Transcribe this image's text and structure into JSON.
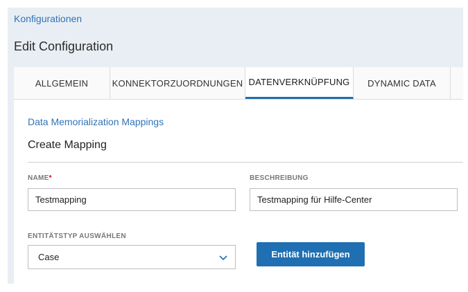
{
  "breadcrumb": "Konfigurationen",
  "page_title": "Edit Configuration",
  "tabs": [
    {
      "label": "ALLGEMEIN",
      "active": false
    },
    {
      "label": "KONNEKTORZUORDNUNGEN",
      "active": false
    },
    {
      "label": "DATENVERKNÜPFUNG",
      "active": true
    },
    {
      "label": "DYNAMIC DATA",
      "active": false
    }
  ],
  "section_title": "Data Memorialization Mappings",
  "form_heading": "Create Mapping",
  "fields": {
    "name": {
      "label": "NAME",
      "required_mark": "*",
      "value": "Testmapping"
    },
    "description": {
      "label": "BESCHREIBUNG",
      "value": "Testmapping für Hilfe-Center"
    },
    "entity_type": {
      "label": "ENTITÄTSTYP AUSWÄHLEN",
      "selected": "Case"
    }
  },
  "add_entity_button": "Entität hinzufügen",
  "colors": {
    "accent": "#1f6fb2",
    "link": "#2f73b8",
    "required": "#d0021b",
    "page_background": "#e9eef4"
  },
  "icons": {
    "select_toggle": "chevron-down-icon"
  }
}
